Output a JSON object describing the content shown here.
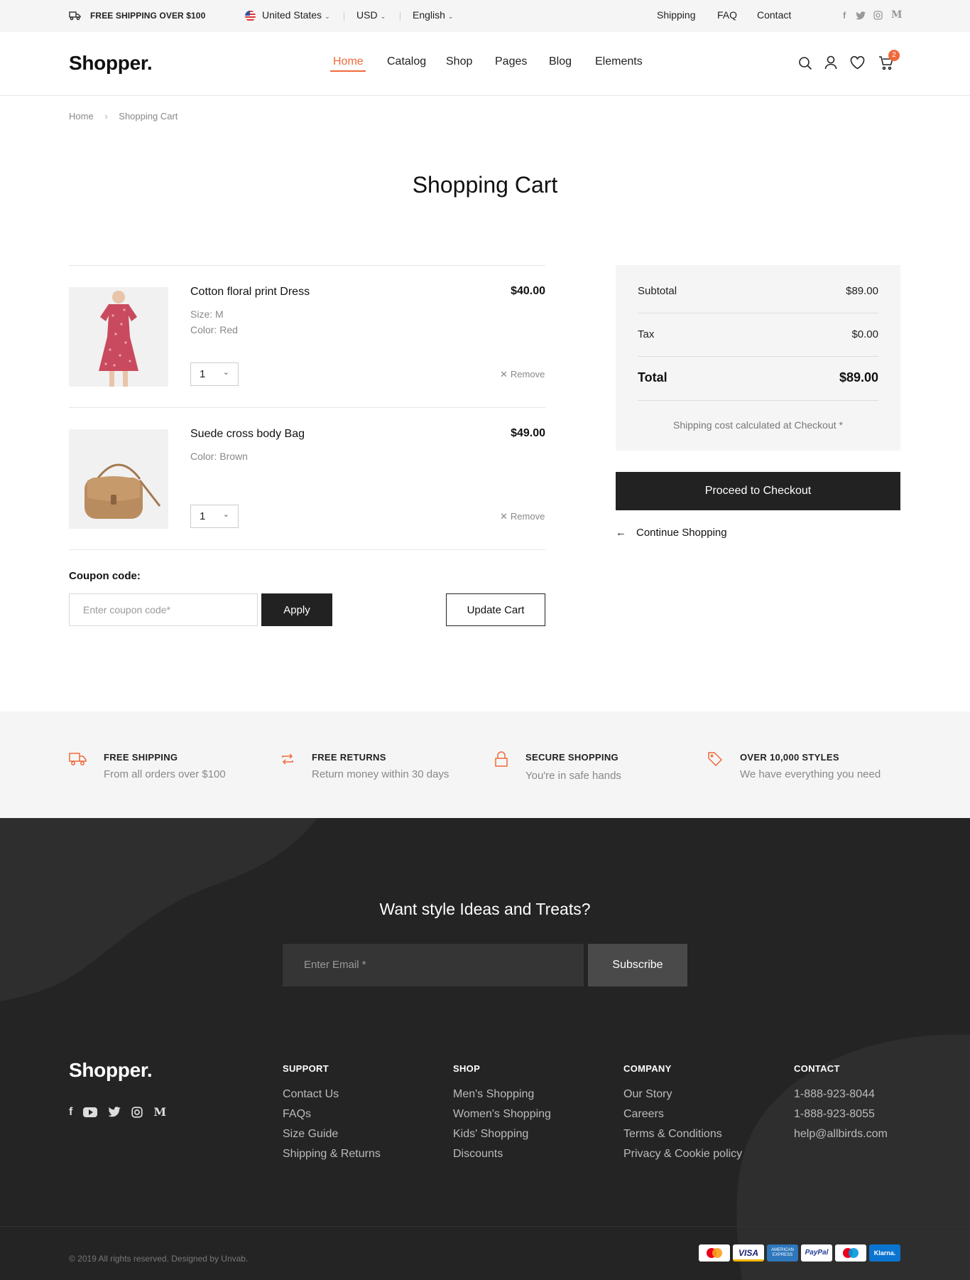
{
  "topbar": {
    "shipping_note": "FREE SHIPPING OVER $100",
    "country": "United States",
    "currency": "USD",
    "language": "English",
    "links": [
      "Shipping",
      "FAQ",
      "Contact"
    ],
    "social_icons": [
      "facebook-icon",
      "twitter-icon",
      "instagram-icon",
      "medium-icon"
    ]
  },
  "header": {
    "logo": "Shopper.",
    "nav": [
      "Home",
      "Catalog",
      "Shop",
      "Pages",
      "Blog",
      "Elements"
    ],
    "active_nav": "Home",
    "cart_count": "2",
    "accent_color": "#f0693a"
  },
  "breadcrumb": {
    "home": "Home",
    "current": "Shopping Cart"
  },
  "page": {
    "title": "Shopping Cart"
  },
  "cart": {
    "items": [
      {
        "name": "Cotton floral print Dress",
        "meta": [
          "Size: M",
          "Color: Red"
        ],
        "price": "$40.00",
        "qty": "1",
        "remove": "Remove"
      },
      {
        "name": "Suede cross body Bag",
        "meta": [
          "Color: Brown"
        ],
        "price": "$49.00",
        "qty": "1",
        "remove": "Remove"
      }
    ],
    "coupon_label": "Coupon code:",
    "coupon_placeholder": "Enter coupon code*",
    "apply": "Apply",
    "update": "Update Cart"
  },
  "summary": {
    "subtotal_label": "Subtotal",
    "subtotal": "$89.00",
    "tax_label": "Tax",
    "tax": "$0.00",
    "total_label": "Total",
    "total": "$89.00",
    "note": "Shipping cost calculated at Checkout *",
    "checkout": "Proceed to Checkout",
    "continue": "Continue Shopping"
  },
  "features": [
    {
      "title": "FREE SHIPPING",
      "sub": "From all orders over $100",
      "icon": "truck-icon"
    },
    {
      "title": "FREE RETURNS",
      "sub": "Return money within 30 days",
      "icon": "returns-icon"
    },
    {
      "title": "SECURE SHOPPING",
      "sub": "You're in safe hands",
      "icon": "lock-icon"
    },
    {
      "title": "OVER 10,000 STYLES",
      "sub": "We have everything you need",
      "icon": "tag-icon"
    }
  ],
  "newsletter": {
    "heading": "Want style Ideas and Treats?",
    "placeholder": "Enter Email *",
    "button": "Subscribe"
  },
  "footer": {
    "logo": "Shopper.",
    "columns": [
      {
        "title": "SUPPORT",
        "links": [
          "Contact Us",
          "FAQs",
          "Size Guide",
          "Shipping & Returns"
        ]
      },
      {
        "title": "SHOP",
        "links": [
          "Men's Shopping",
          "Women's Shopping",
          "Kids' Shopping",
          "Discounts"
        ]
      },
      {
        "title": "COMPANY",
        "links": [
          "Our Story",
          "Careers",
          "Terms & Conditions",
          "Privacy & Cookie policy"
        ]
      },
      {
        "title": "CONTACT",
        "links": [
          "1-888-923-8044",
          "1-888-923-8055",
          "help@allbirds.com"
        ]
      }
    ],
    "copyright": "© 2019 All rights reserved. Designed by Unvab.",
    "payments": {
      "visa": "VISA",
      "amex_lines": [
        "AMERICAN",
        "EXPRESS"
      ],
      "paypal": "PayPal",
      "klarna": "Klarna."
    }
  }
}
